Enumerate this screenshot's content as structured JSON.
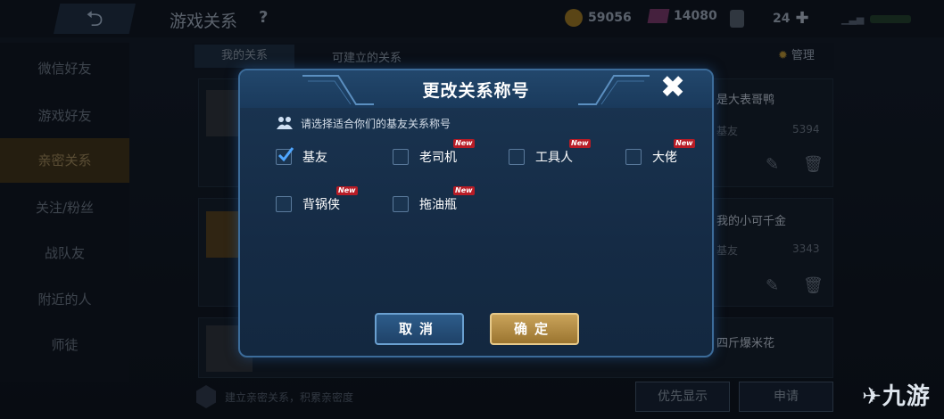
{
  "header": {
    "back_glyph": "⮌",
    "title": "游戏关系",
    "help": "?",
    "gold": "59056",
    "gems": "14080",
    "tickets": "24"
  },
  "tabs": [
    "我的关系",
    "可建立的关系"
  ],
  "manage_label": "管理",
  "sidebar": [
    "微信好友",
    "游戏好友",
    "亲密关系",
    "关注/粉丝",
    "战队友",
    "附近的人",
    "师徒"
  ],
  "right_cards": [
    {
      "name": "是大表哥鸭",
      "sub": "基友",
      "num": "5394"
    },
    {
      "name": "我的小可千金",
      "sub": "基友",
      "num": "3343"
    },
    {
      "name": "四斤爆米花",
      "sub": "",
      "num": ""
    }
  ],
  "bottom": {
    "hint": "建立亲密关系，积累亲密度",
    "priority_btn": "优先显示",
    "apply_btn": "申请"
  },
  "watermark": "九游",
  "dialog": {
    "title": "更改关系称号",
    "close": "✖",
    "instruction": "请选择适合你们的基友关系称号",
    "new_badge": "New",
    "options": [
      {
        "label": "基友",
        "checked": true,
        "is_new": false
      },
      {
        "label": "老司机",
        "checked": false,
        "is_new": true
      },
      {
        "label": "工具人",
        "checked": false,
        "is_new": true
      },
      {
        "label": "大佬",
        "checked": false,
        "is_new": true
      },
      {
        "label": "背锅侠",
        "checked": false,
        "is_new": true
      },
      {
        "label": "拖油瓶",
        "checked": false,
        "is_new": true
      }
    ],
    "cancel": "取消",
    "confirm": "确定"
  },
  "colors": {
    "dialog_border": "#3c6c9a",
    "confirm_gold": "#c9a35a",
    "cancel_blue": "#2d5c8a",
    "new_badge_red": "#b81c26"
  }
}
